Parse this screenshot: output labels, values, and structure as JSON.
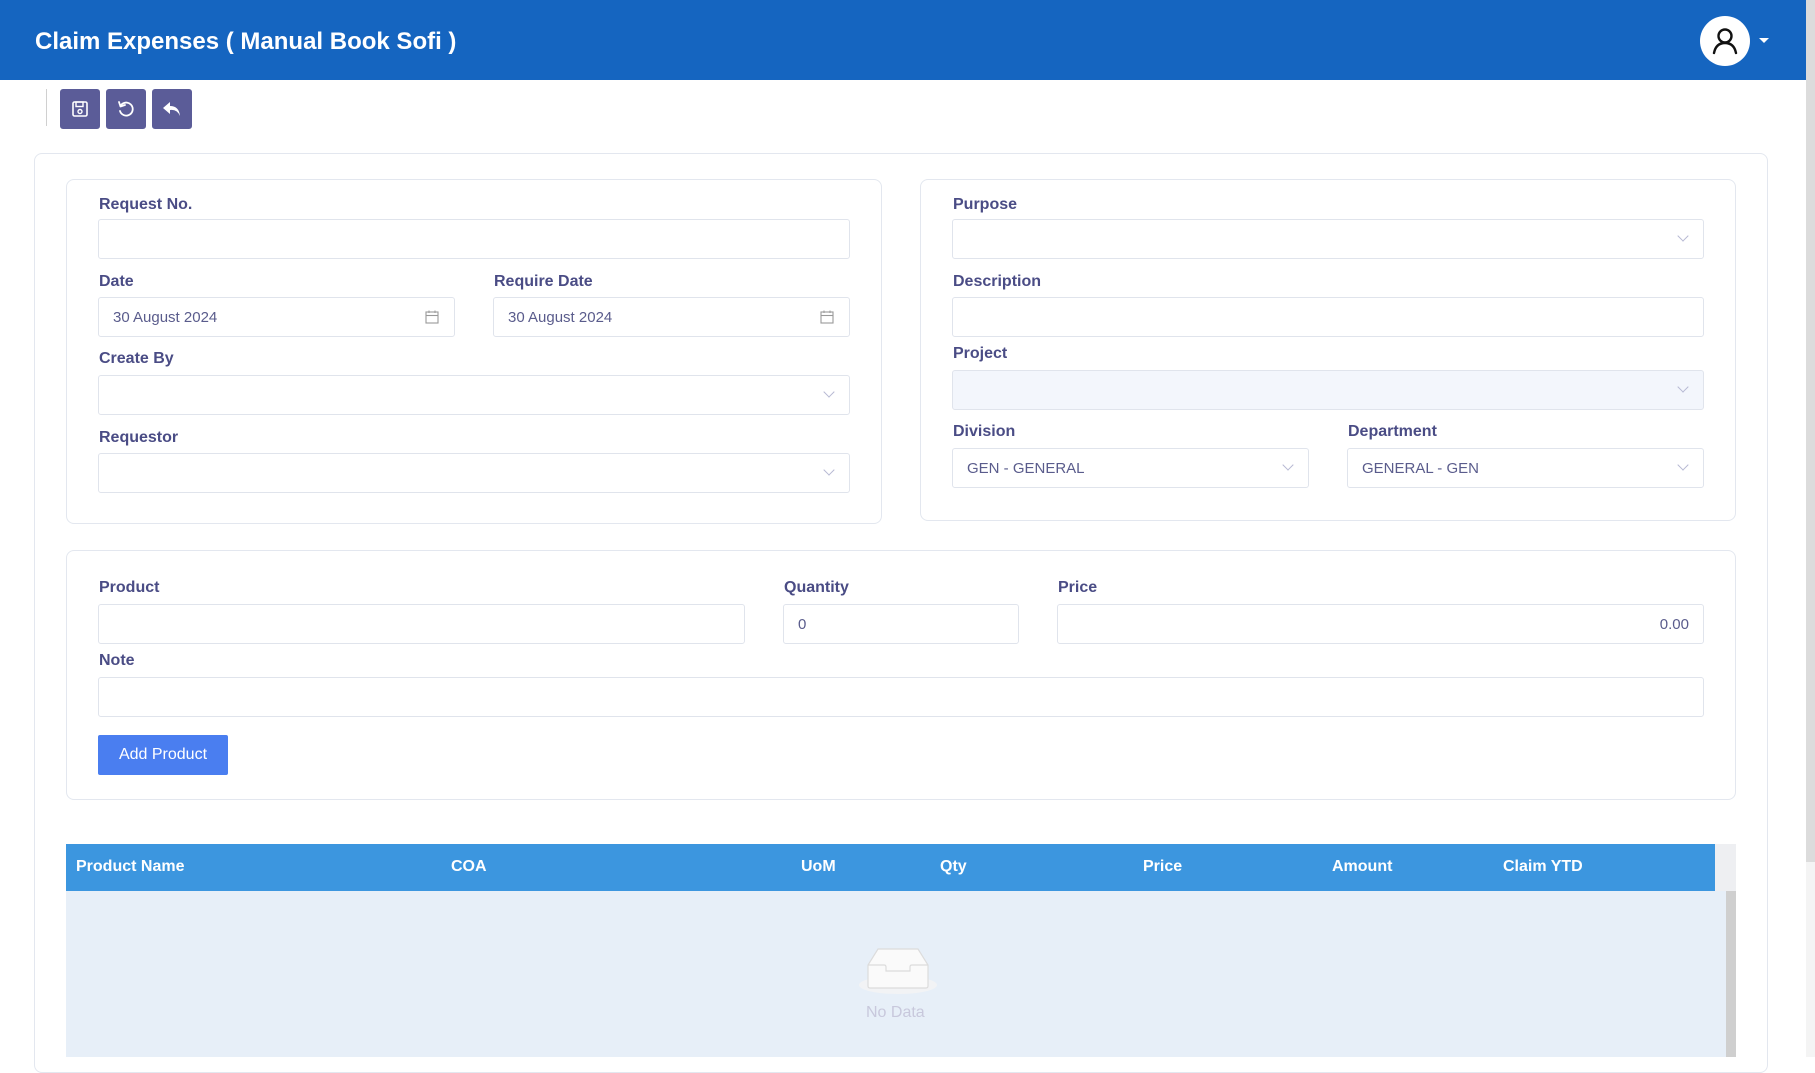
{
  "header": {
    "title": "Claim Expenses ( Manual Book Sofi )",
    "avatar_icon": "user-icon",
    "menu_icon": "caret-down-icon"
  },
  "toolbar": {
    "buttons": [
      {
        "name": "save",
        "icon": "save-icon"
      },
      {
        "name": "refresh",
        "icon": "refresh-icon"
      },
      {
        "name": "back",
        "icon": "undo-arrow-icon"
      }
    ]
  },
  "form": {
    "request_no": {
      "label": "Request No.",
      "value": ""
    },
    "date": {
      "label": "Date",
      "value": "30 August 2024"
    },
    "require_date": {
      "label": "Require Date",
      "value": "30 August 2024"
    },
    "create_by": {
      "label": "Create By",
      "value": ""
    },
    "requestor": {
      "label": "Requestor",
      "value": ""
    },
    "purpose": {
      "label": "Purpose",
      "value": ""
    },
    "description": {
      "label": "Description",
      "value": ""
    },
    "project": {
      "label": "Project",
      "value": ""
    },
    "division": {
      "label": "Division",
      "value": "GEN - GENERAL"
    },
    "department": {
      "label": "Department",
      "value": "GENERAL - GEN"
    }
  },
  "product_form": {
    "product": {
      "label": "Product",
      "value": ""
    },
    "quantity": {
      "label": "Quantity",
      "value": "0"
    },
    "price": {
      "label": "Price",
      "value": "0.00"
    },
    "note": {
      "label": "Note",
      "value": ""
    },
    "add_button": "Add Product"
  },
  "table": {
    "columns": [
      "Product Name",
      "COA",
      "UoM",
      "Qty",
      "Price",
      "Amount",
      "Claim YTD"
    ],
    "rows": [],
    "empty_text": "No Data"
  },
  "colors": {
    "header_bg": "#1565c0",
    "toolbar_btn": "#5b5c98",
    "label": "#4a4c85",
    "add_button": "#4a7ef0",
    "table_header": "#3c96df",
    "table_body": "#e7eff8"
  }
}
